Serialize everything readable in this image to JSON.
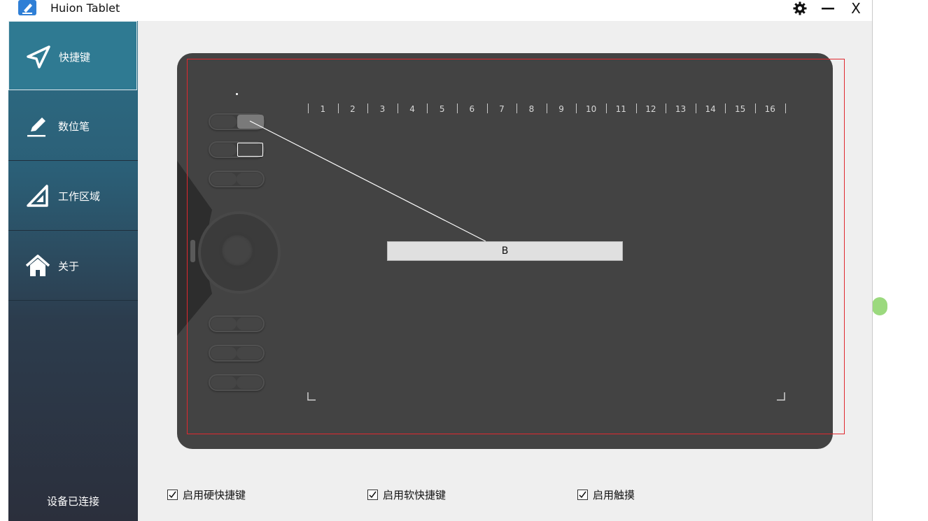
{
  "window": {
    "title": "Huion Tablet",
    "settings_icon": "gear-icon",
    "minimize_icon": "minimize-icon",
    "close_label": "X"
  },
  "sidebar": {
    "items": [
      {
        "label": "快捷键",
        "icon": "send-arrow-icon",
        "active": true
      },
      {
        "label": "数位笔",
        "icon": "pen-icon",
        "active": false
      },
      {
        "label": "工作区域",
        "icon": "set-square-icon",
        "active": false
      },
      {
        "label": "关于",
        "icon": "home-icon",
        "active": false
      }
    ],
    "status": "设备已连接"
  },
  "tablet": {
    "scale_labels": [
      "1",
      "2",
      "3",
      "4",
      "5",
      "6",
      "7",
      "8",
      "9",
      "10",
      "11",
      "12",
      "13",
      "14",
      "15",
      "16"
    ],
    "callout_label": "B"
  },
  "options": [
    {
      "label": "启用硬快捷键",
      "checked": true
    },
    {
      "label": "启用软快捷键",
      "checked": true
    },
    {
      "label": "启用触摸",
      "checked": true
    }
  ],
  "colors": {
    "accent_sidebar": "#2f7a92",
    "active_area_border": "#e0282f",
    "tablet_body": "#434343"
  }
}
